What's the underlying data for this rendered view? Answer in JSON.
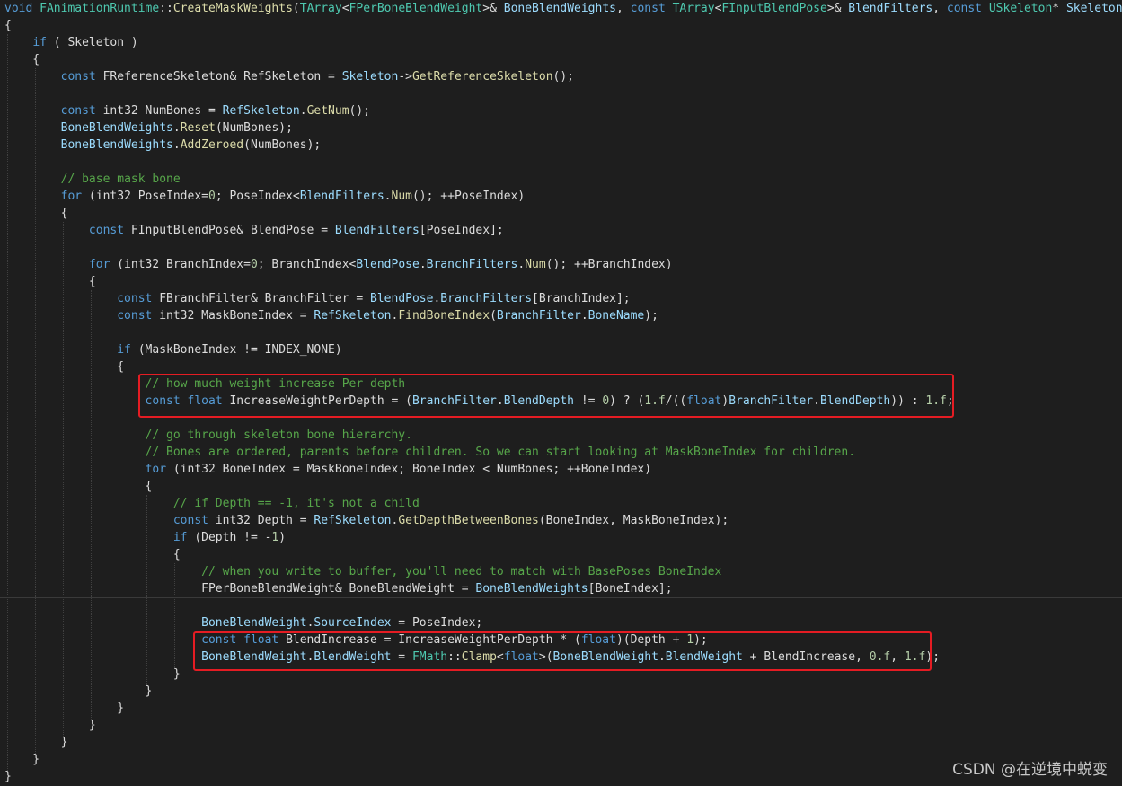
{
  "colors": {
    "background": "#1e1e1e",
    "keyword": "#569cd6",
    "type": "#4ec9b0",
    "function": "#dcdcaa",
    "variable": "#9cdcfe",
    "comment": "#57a64a",
    "number": "#b5cea8",
    "plain": "#dcdcdc",
    "highlight_box": "#e51c23"
  },
  "watermark": "CSDN @在逆境中蜕变",
  "lines": [
    [
      [
        "kw",
        "void "
      ],
      [
        "ty",
        "FAnimationRuntime"
      ],
      [
        "pl",
        "::"
      ],
      [
        "fn",
        "CreateMaskWeights"
      ],
      [
        "pl",
        "("
      ],
      [
        "ty",
        "TArray"
      ],
      [
        "pl",
        "<"
      ],
      [
        "ty",
        "FPerBoneBlendWeight"
      ],
      [
        "pl",
        ">& "
      ],
      [
        "var",
        "BoneBlendWeights"
      ],
      [
        "pl",
        ", "
      ],
      [
        "kw",
        "const "
      ],
      [
        "ty",
        "TArray"
      ],
      [
        "pl",
        "<"
      ],
      [
        "ty",
        "FInputBlendPose"
      ],
      [
        "pl",
        ">& "
      ],
      [
        "var",
        "BlendFilters"
      ],
      [
        "pl",
        ", "
      ],
      [
        "kw",
        "const "
      ],
      [
        "ty",
        "USkeleton"
      ],
      [
        "pl",
        "* "
      ],
      [
        "var",
        "Skeleton"
      ],
      [
        "pl",
        ")"
      ]
    ],
    [
      [
        "pl",
        "{"
      ]
    ],
    [
      [
        "pl",
        "    "
      ],
      [
        "kw",
        "if"
      ],
      [
        "pl",
        " ( Skeleton )"
      ]
    ],
    [
      [
        "pl",
        "    {"
      ]
    ],
    [
      [
        "pl",
        "        "
      ],
      [
        "kw",
        "const "
      ],
      [
        "pl",
        "FReferenceSkeleton& RefSkeleton = "
      ],
      [
        "var",
        "Skeleton"
      ],
      [
        "pl",
        "->"
      ],
      [
        "fn",
        "GetReferenceSkeleton"
      ],
      [
        "pl",
        "();"
      ]
    ],
    [
      [
        "pl",
        ""
      ]
    ],
    [
      [
        "pl",
        "        "
      ],
      [
        "kw",
        "const "
      ],
      [
        "pl",
        "int32 NumBones = "
      ],
      [
        "var",
        "RefSkeleton"
      ],
      [
        "pl",
        "."
      ],
      [
        "fn",
        "GetNum"
      ],
      [
        "pl",
        "();"
      ]
    ],
    [
      [
        "pl",
        "        "
      ],
      [
        "var",
        "BoneBlendWeights"
      ],
      [
        "pl",
        "."
      ],
      [
        "fn",
        "Reset"
      ],
      [
        "pl",
        "(NumBones);"
      ]
    ],
    [
      [
        "pl",
        "        "
      ],
      [
        "var",
        "BoneBlendWeights"
      ],
      [
        "pl",
        "."
      ],
      [
        "fn",
        "AddZeroed"
      ],
      [
        "pl",
        "(NumBones);"
      ]
    ],
    [
      [
        "pl",
        ""
      ]
    ],
    [
      [
        "pl",
        "        "
      ],
      [
        "cm",
        "// base mask bone"
      ]
    ],
    [
      [
        "pl",
        "        "
      ],
      [
        "kw",
        "for"
      ],
      [
        "pl",
        " (int32 PoseIndex="
      ],
      [
        "num",
        "0"
      ],
      [
        "pl",
        "; PoseIndex<"
      ],
      [
        "var",
        "BlendFilters"
      ],
      [
        "pl",
        "."
      ],
      [
        "fn",
        "Num"
      ],
      [
        "pl",
        "(); ++PoseIndex)"
      ]
    ],
    [
      [
        "pl",
        "        {"
      ]
    ],
    [
      [
        "pl",
        "            "
      ],
      [
        "kw",
        "const "
      ],
      [
        "pl",
        "FInputBlendPose& BlendPose = "
      ],
      [
        "var",
        "BlendFilters"
      ],
      [
        "pl",
        "[PoseIndex];"
      ]
    ],
    [
      [
        "pl",
        ""
      ]
    ],
    [
      [
        "pl",
        "            "
      ],
      [
        "kw",
        "for"
      ],
      [
        "pl",
        " (int32 BranchIndex="
      ],
      [
        "num",
        "0"
      ],
      [
        "pl",
        "; BranchIndex<"
      ],
      [
        "var",
        "BlendPose"
      ],
      [
        "pl",
        "."
      ],
      [
        "var",
        "BranchFilters"
      ],
      [
        "pl",
        "."
      ],
      [
        "fn",
        "Num"
      ],
      [
        "pl",
        "(); ++BranchIndex)"
      ]
    ],
    [
      [
        "pl",
        "            {"
      ]
    ],
    [
      [
        "pl",
        "                "
      ],
      [
        "kw",
        "const "
      ],
      [
        "pl",
        "FBranchFilter& BranchFilter = "
      ],
      [
        "var",
        "BlendPose"
      ],
      [
        "pl",
        "."
      ],
      [
        "var",
        "BranchFilters"
      ],
      [
        "pl",
        "[BranchIndex];"
      ]
    ],
    [
      [
        "pl",
        "                "
      ],
      [
        "kw",
        "const "
      ],
      [
        "pl",
        "int32 MaskBoneIndex = "
      ],
      [
        "var",
        "RefSkeleton"
      ],
      [
        "pl",
        "."
      ],
      [
        "fn",
        "FindBoneIndex"
      ],
      [
        "pl",
        "("
      ],
      [
        "var",
        "BranchFilter"
      ],
      [
        "pl",
        "."
      ],
      [
        "var",
        "BoneName"
      ],
      [
        "pl",
        ");"
      ]
    ],
    [
      [
        "pl",
        ""
      ]
    ],
    [
      [
        "pl",
        "                "
      ],
      [
        "kw",
        "if"
      ],
      [
        "pl",
        " (MaskBoneIndex != INDEX_NONE)"
      ]
    ],
    [
      [
        "pl",
        "                {"
      ]
    ],
    [
      [
        "pl",
        "                    "
      ],
      [
        "cm",
        "// how much weight increase Per depth"
      ]
    ],
    [
      [
        "pl",
        "                    "
      ],
      [
        "kw",
        "const float "
      ],
      [
        "pl",
        "IncreaseWeightPerDepth = ("
      ],
      [
        "var",
        "BranchFilter"
      ],
      [
        "pl",
        "."
      ],
      [
        "var",
        "BlendDepth"
      ],
      [
        "pl",
        " != "
      ],
      [
        "num",
        "0"
      ],
      [
        "pl",
        ") ? ("
      ],
      [
        "num",
        "1.f"
      ],
      [
        "pl",
        "/(("
      ],
      [
        "kw",
        "float"
      ],
      [
        "pl",
        ")"
      ],
      [
        "var",
        "BranchFilter"
      ],
      [
        "pl",
        "."
      ],
      [
        "var",
        "BlendDepth"
      ],
      [
        "pl",
        ")) : "
      ],
      [
        "num",
        "1.f"
      ],
      [
        "pl",
        ";"
      ]
    ],
    [
      [
        "pl",
        ""
      ]
    ],
    [
      [
        "pl",
        "                    "
      ],
      [
        "cm",
        "// go through skeleton bone hierarchy."
      ]
    ],
    [
      [
        "pl",
        "                    "
      ],
      [
        "cm",
        "// Bones are ordered, parents before children. So we can start looking at MaskBoneIndex for children."
      ]
    ],
    [
      [
        "pl",
        "                    "
      ],
      [
        "kw",
        "for"
      ],
      [
        "pl",
        " (int32 BoneIndex = MaskBoneIndex; BoneIndex < NumBones; ++BoneIndex)"
      ]
    ],
    [
      [
        "pl",
        "                    {"
      ]
    ],
    [
      [
        "pl",
        "                        "
      ],
      [
        "cm",
        "// if Depth == -1, it's not a child"
      ]
    ],
    [
      [
        "pl",
        "                        "
      ],
      [
        "kw",
        "const "
      ],
      [
        "pl",
        "int32 Depth = "
      ],
      [
        "var",
        "RefSkeleton"
      ],
      [
        "pl",
        "."
      ],
      [
        "fn",
        "GetDepthBetweenBones"
      ],
      [
        "pl",
        "(BoneIndex, MaskBoneIndex);"
      ]
    ],
    [
      [
        "pl",
        "                        "
      ],
      [
        "kw",
        "if"
      ],
      [
        "pl",
        " (Depth != -"
      ],
      [
        "num",
        "1"
      ],
      [
        "pl",
        ")"
      ]
    ],
    [
      [
        "pl",
        "                        {"
      ]
    ],
    [
      [
        "pl",
        "                            "
      ],
      [
        "cm",
        "// when you write to buffer, you'll need to match with BasePoses BoneIndex"
      ]
    ],
    [
      [
        "pl",
        "                            "
      ],
      [
        "pl",
        "FPerBoneBlendWeight& BoneBlendWeight = "
      ],
      [
        "var",
        "BoneBlendWeights"
      ],
      [
        "pl",
        "[BoneIndex];"
      ]
    ],
    [
      [
        "pl",
        ""
      ]
    ],
    [
      [
        "pl",
        "                            "
      ],
      [
        "var",
        "BoneBlendWeight"
      ],
      [
        "pl",
        "."
      ],
      [
        "var",
        "SourceIndex"
      ],
      [
        "pl",
        " = PoseIndex;"
      ]
    ],
    [
      [
        "pl",
        "                            "
      ],
      [
        "kw",
        "const float "
      ],
      [
        "pl",
        "BlendIncrease = IncreaseWeightPerDepth * ("
      ],
      [
        "kw",
        "float"
      ],
      [
        "pl",
        ")(Depth + "
      ],
      [
        "num",
        "1"
      ],
      [
        "pl",
        ");"
      ]
    ],
    [
      [
        "pl",
        "                            "
      ],
      [
        "var",
        "BoneBlendWeight"
      ],
      [
        "pl",
        "."
      ],
      [
        "var",
        "BlendWeight"
      ],
      [
        "pl",
        " = "
      ],
      [
        "ty",
        "FMath"
      ],
      [
        "pl",
        "::"
      ],
      [
        "fn",
        "Clamp"
      ],
      [
        "pl",
        "<"
      ],
      [
        "kw",
        "float"
      ],
      [
        "pl",
        ">("
      ],
      [
        "var",
        "BoneBlendWeight"
      ],
      [
        "pl",
        "."
      ],
      [
        "var",
        "BlendWeight"
      ],
      [
        "pl",
        " + BlendIncrease, "
      ],
      [
        "num",
        "0.f"
      ],
      [
        "pl",
        ", "
      ],
      [
        "num",
        "1.f"
      ],
      [
        "pl",
        ");"
      ]
    ],
    [
      [
        "pl",
        "                        }"
      ]
    ],
    [
      [
        "pl",
        "                    }"
      ]
    ],
    [
      [
        "pl",
        "                }"
      ]
    ],
    [
      [
        "pl",
        "            }"
      ]
    ],
    [
      [
        "pl",
        "        }"
      ]
    ],
    [
      [
        "pl",
        "    }"
      ]
    ],
    [
      [
        "pl",
        "}"
      ]
    ]
  ]
}
